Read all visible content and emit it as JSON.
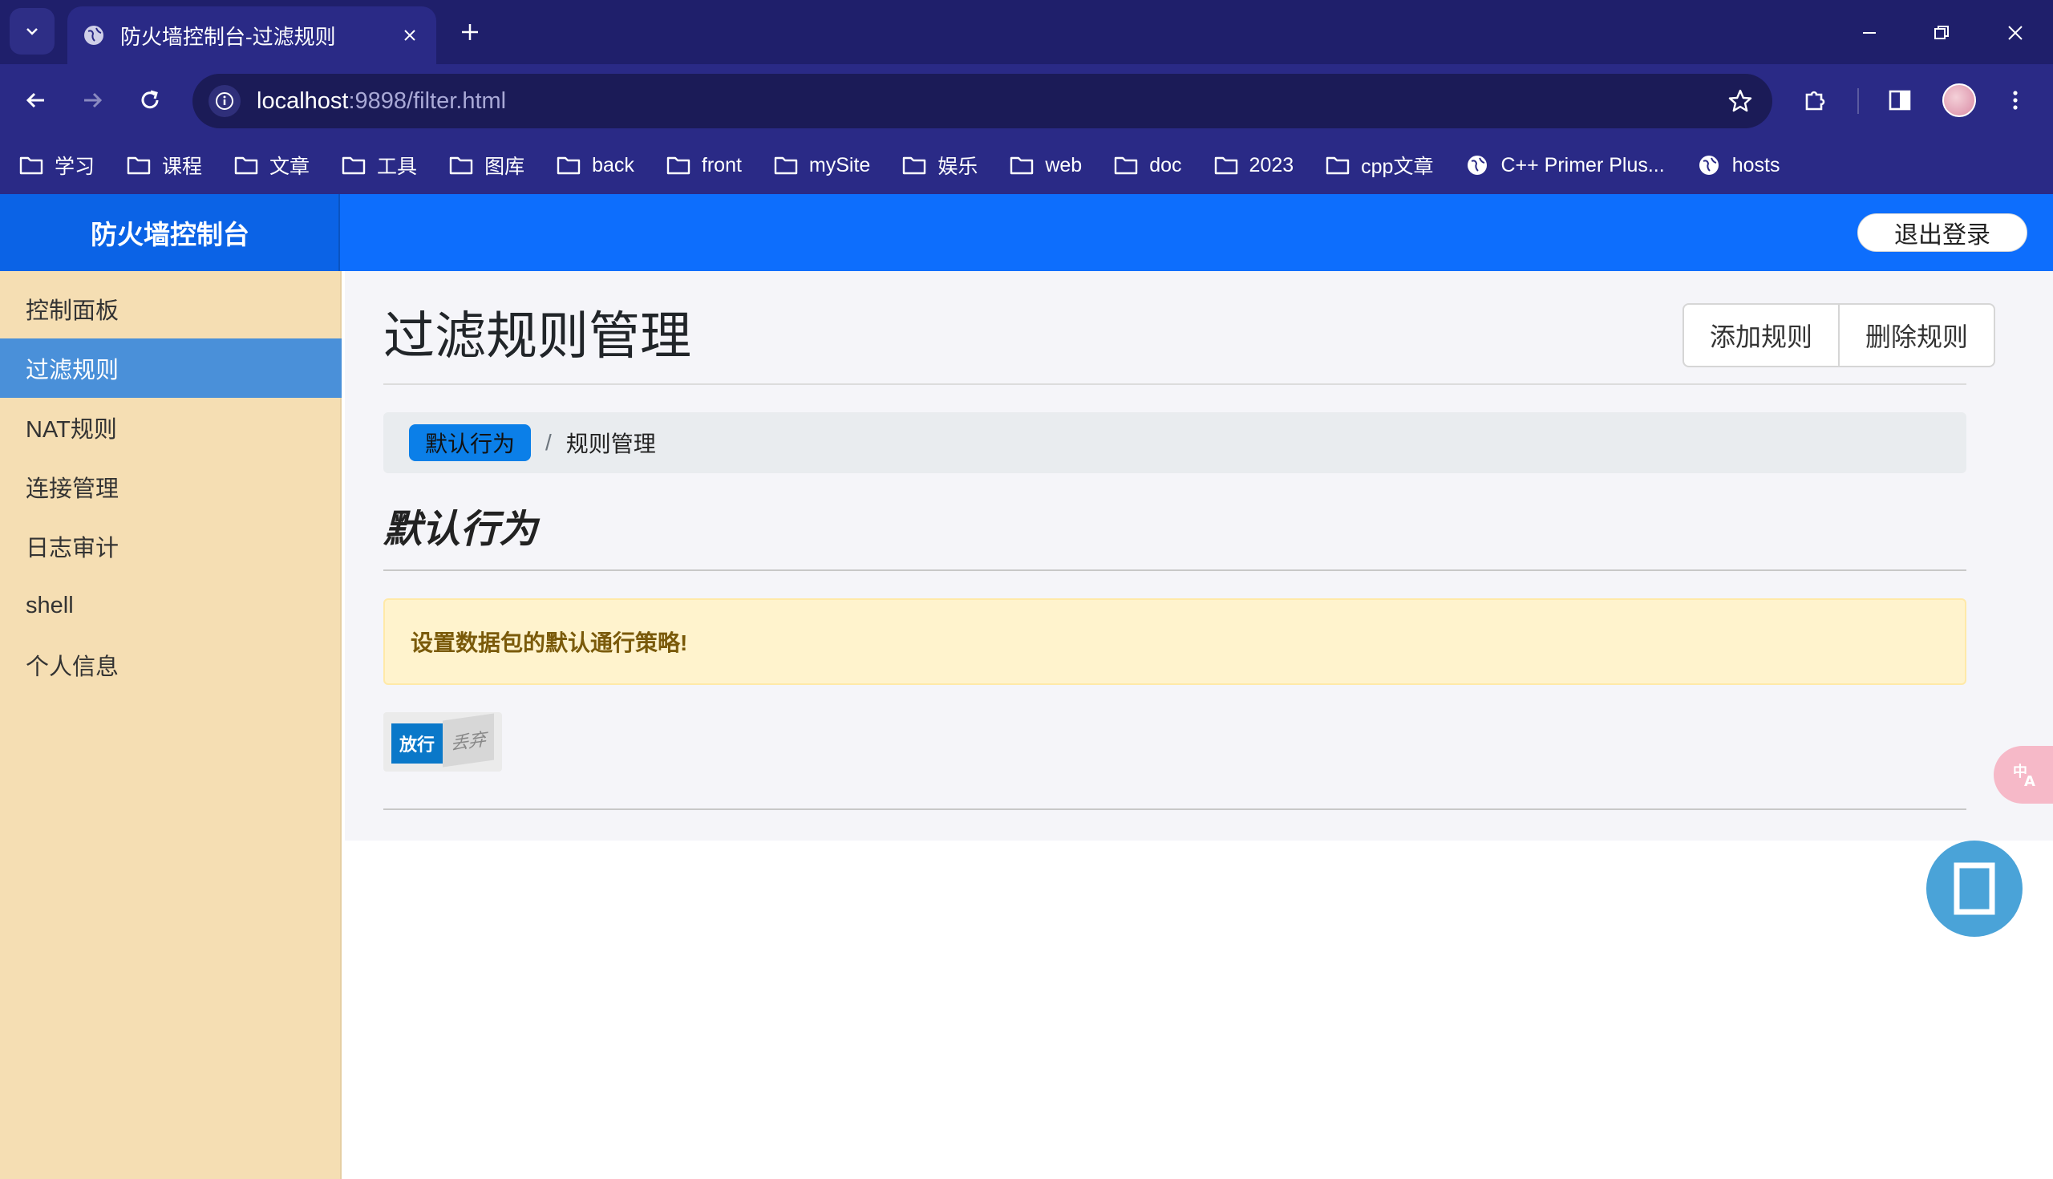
{
  "browser": {
    "tab_title": "防火墙控制台-过滤规则",
    "url_host": "localhost",
    "url_rest": ":9898/filter.html",
    "bookmarks": [
      {
        "label": "学习",
        "icon": "folder-icon"
      },
      {
        "label": "课程",
        "icon": "folder-icon"
      },
      {
        "label": "文章",
        "icon": "folder-icon"
      },
      {
        "label": "工具",
        "icon": "folder-icon"
      },
      {
        "label": "图库",
        "icon": "folder-icon"
      },
      {
        "label": "back",
        "icon": "folder-icon"
      },
      {
        "label": "front",
        "icon": "folder-icon"
      },
      {
        "label": "mySite",
        "icon": "folder-icon"
      },
      {
        "label": "娱乐",
        "icon": "folder-icon"
      },
      {
        "label": "web",
        "icon": "folder-icon"
      },
      {
        "label": "doc",
        "icon": "folder-icon"
      },
      {
        "label": "2023",
        "icon": "folder-icon"
      },
      {
        "label": "cpp文章",
        "icon": "folder-icon"
      },
      {
        "label": "C++ Primer Plus...",
        "icon": "globe-icon"
      },
      {
        "label": "hosts",
        "icon": "globe-icon"
      }
    ]
  },
  "app": {
    "brand": "防火墙控制台",
    "logout_label": "退出登录",
    "sidebar": [
      {
        "label": "控制面板",
        "active": false
      },
      {
        "label": "过滤规则",
        "active": true
      },
      {
        "label": "NAT规则",
        "active": false
      },
      {
        "label": "连接管理",
        "active": false
      },
      {
        "label": "日志审计",
        "active": false
      },
      {
        "label": "shell",
        "active": false
      },
      {
        "label": "个人信息",
        "active": false
      }
    ],
    "main": {
      "title": "过滤规则管理",
      "add_button": "添加规则",
      "delete_button": "删除规则",
      "breadcrumb_active": "默认行为",
      "breadcrumb_sep": "/",
      "breadcrumb_current": "规则管理",
      "section_title": "默认行为",
      "alert_text": "设置数据包的默认通行策略!",
      "switch_on_label": "放行",
      "switch_off_label": "丢弃",
      "switch_state": "on"
    }
  },
  "colors": {
    "chrome_dark": "#1f1f6b",
    "chrome": "#2a2a86",
    "topbar": "#0d6efd",
    "sidebar": "#f5deb3",
    "sidebar_active": "#4a90d9",
    "alert_bg": "#fff3cd"
  }
}
